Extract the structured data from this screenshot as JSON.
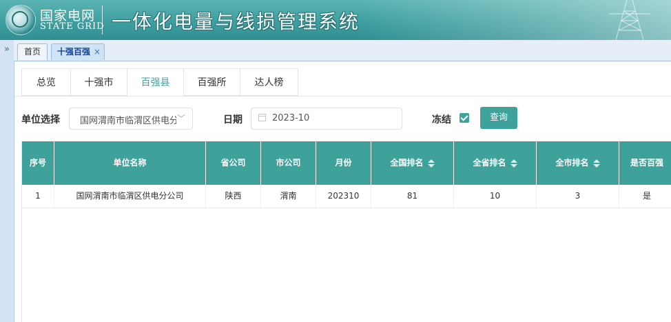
{
  "header": {
    "brand_cn": "国家电网",
    "brand_en": "STATE GRID",
    "system_title": "一体化电量与线损管理系统"
  },
  "page_tabs": [
    {
      "label": "首页"
    },
    {
      "label": "十强百强",
      "close": "×"
    }
  ],
  "sub_tabs": [
    {
      "label": "总览"
    },
    {
      "label": "十强市"
    },
    {
      "label": "百强县"
    },
    {
      "label": "百强所"
    },
    {
      "label": "达人榜"
    }
  ],
  "filters": {
    "unit_label": "单位选择",
    "unit_value": "国网渭南市临渭区供电分公司",
    "date_label": "日期",
    "date_value": "2023-10",
    "freeze_label": "冻结",
    "freeze_checked": true,
    "query_label": "查询"
  },
  "table": {
    "columns": [
      "序号",
      "单位名称",
      "省公司",
      "市公司",
      "月份",
      "全国排名",
      "全省排名",
      "全市排名",
      "是否百强"
    ],
    "rows": [
      [
        "1",
        "国网渭南市临渭区供电分公司",
        "陕西",
        "渭南",
        "202310",
        "81",
        "10",
        "3",
        "是"
      ]
    ]
  },
  "colors": {
    "accent": "#3ea29a",
    "header_bg": "#3f9fa0"
  }
}
